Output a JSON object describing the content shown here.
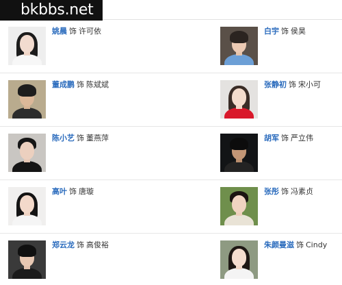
{
  "watermark": "bkbbs.net",
  "colors": {
    "link": "#2a6bbd",
    "text": "#333333",
    "divider": "#e6e6e6"
  },
  "rows": [
    {
      "left": {
        "actor": "姚晨",
        "plays": "饰",
        "role": "许可依",
        "photo_icon": "portrait-woman-white-top"
      },
      "right": {
        "actor": "白宇",
        "plays": "饰",
        "role": "侯昊",
        "photo_icon": "portrait-man-blue-shirt"
      }
    },
    {
      "left": {
        "actor": "董成鹏",
        "plays": "饰",
        "role": "陈斌斌",
        "photo_icon": "portrait-man-outdoor-glasses"
      },
      "right": {
        "actor": "张静初",
        "plays": "饰",
        "role": "宋小可",
        "photo_icon": "portrait-woman-red-dress"
      }
    },
    {
      "left": {
        "actor": "陈小艺",
        "plays": "饰",
        "role": "董燕萍",
        "photo_icon": "portrait-woman-black-outfit"
      },
      "right": {
        "actor": "胡军",
        "plays": "饰",
        "role": "严立伟",
        "photo_icon": "portrait-man-black-suit"
      }
    },
    {
      "left": {
        "actor": "高叶",
        "plays": "饰",
        "role": "唐璇",
        "photo_icon": "portrait-woman-white-top"
      },
      "right": {
        "actor": "张彤",
        "plays": "饰",
        "role": "冯素贞",
        "photo_icon": "portrait-woman-outdoor"
      }
    },
    {
      "left": {
        "actor": "郑云龙",
        "plays": "饰",
        "role": "高俊裕",
        "photo_icon": "portrait-man-dark-jacket"
      },
      "right": {
        "actor": "朱颜曼滋",
        "plays": "饰",
        "role": "Cindy",
        "photo_icon": "portrait-woman-white-top"
      }
    }
  ]
}
